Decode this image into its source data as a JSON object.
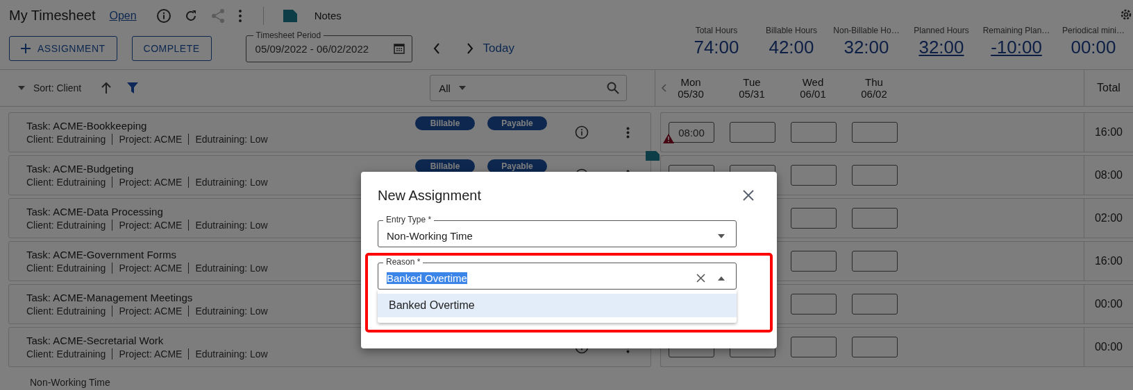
{
  "header": {
    "title": "My Timesheet",
    "status": "Open",
    "notes_label": "Notes",
    "share_disabled": true
  },
  "toolbar": {
    "buttons": [
      {
        "label": "ASSIGNMENT",
        "kind": "add"
      },
      {
        "label": "COMPLETE",
        "kind": "plain"
      }
    ],
    "period": {
      "label": "Timesheet Period",
      "value": "05/09/2022 - 06/02/2022"
    },
    "today": "Today"
  },
  "summary": [
    {
      "label": "Total Hours",
      "value": "74:00",
      "link": false
    },
    {
      "label": "Billable Hours",
      "value": "42:00",
      "link": false
    },
    {
      "label": "Non-Billable Ho…",
      "value": "32:00",
      "link": false
    },
    {
      "label": "Planned Hours",
      "value": "32:00",
      "link": true
    },
    {
      "label": "Remaining Plan…",
      "value": "-10:00",
      "link": true
    },
    {
      "label": "Periodical mini…",
      "value": "00:00",
      "link": false
    }
  ],
  "list_controls": {
    "sort": "Sort: Client",
    "filter": "All"
  },
  "days": [
    {
      "day": "Mon",
      "date": "05/30"
    },
    {
      "day": "Tue",
      "date": "05/31"
    },
    {
      "day": "Wed",
      "date": "06/01"
    },
    {
      "day": "Thu",
      "date": "06/02"
    }
  ],
  "total_header": "Total",
  "rows": [
    {
      "task": "Task: ACME-Bookkeeping",
      "meta": [
        "Client: Edutraining",
        "Project: ACME",
        "Edutraining: Low"
      ],
      "tags": [
        "Billable",
        "Payable"
      ],
      "warning": true,
      "note": false,
      "hours": [
        "08:00"
      ],
      "total": "16:00"
    },
    {
      "task": "Task: ACME-Budgeting",
      "meta": [
        "Client: Edutraining",
        "Project: ACME",
        "Edutraining: Low"
      ],
      "tags": [
        "Billable",
        "Payable"
      ],
      "warning": false,
      "note": true,
      "total": "08:00"
    },
    {
      "task": "Task: ACME-Data Processing",
      "meta": [
        "Client: Edutraining",
        "Project: ACME",
        "Edutraining: Low"
      ],
      "warning": false,
      "note": false,
      "total": "02:00"
    },
    {
      "task": "Task: ACME-Government Forms",
      "meta": [
        "Client: Edutraining",
        "Project: ACME",
        "Edutraining: Low"
      ],
      "warning": false,
      "note": false,
      "total": "16:00"
    },
    {
      "task": "Task: ACME-Management Meetings",
      "meta": [
        "Client: Edutraining",
        "Project: ACME",
        "Edutraining: Low"
      ],
      "warning": false,
      "note": false,
      "total": "00:00"
    },
    {
      "task": "Task: ACME-Secretarial Work",
      "meta": [
        "Client: Edutraining",
        "Project: ACME",
        "Edutraining: Low"
      ],
      "warning": false,
      "note": false,
      "total": "00:00"
    }
  ],
  "group_label": "Non-Working Time",
  "dialog": {
    "title": "New Assignment",
    "fields": [
      {
        "label": "Entry Type *",
        "value": "Non-Working Time",
        "expanded": false,
        "value_highlighted": false,
        "outlined": false,
        "clearable": false
      },
      {
        "label": "Reason *",
        "value": "Banked Overtime",
        "expanded": true,
        "value_highlighted": true,
        "outlined": true,
        "clearable": true,
        "options": [
          {
            "label": "Banked Overtime",
            "selected": true
          }
        ]
      }
    ]
  }
}
